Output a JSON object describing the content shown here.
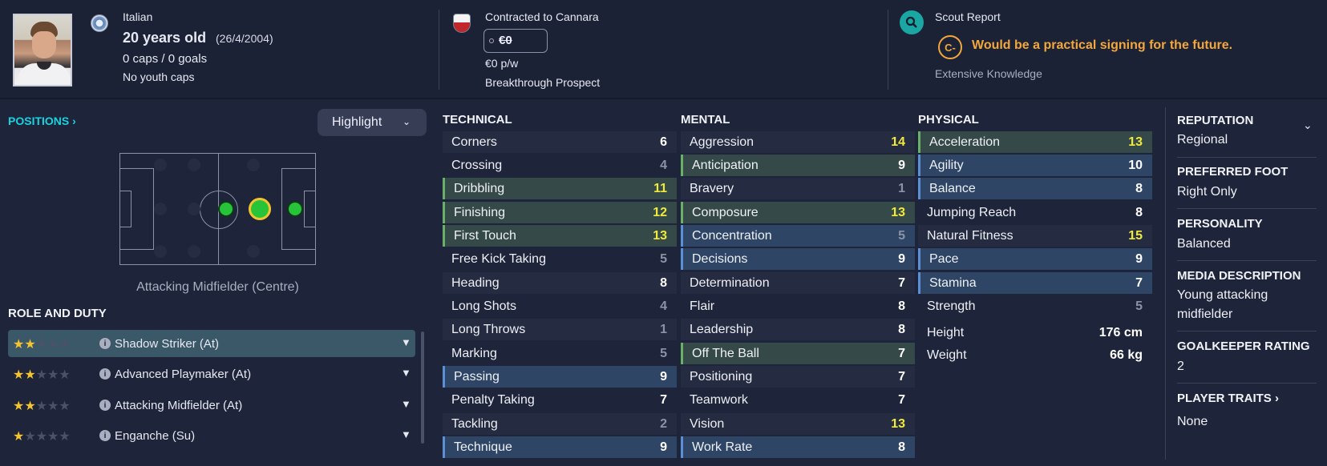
{
  "header": {
    "nationality": "Italian",
    "age_main": "20 years old",
    "dob": "(26/4/2004)",
    "caps": "0 caps / 0 goals",
    "youth_caps": "No youth caps",
    "contract": "Contracted to Cannara",
    "value": "€0",
    "wage": "€0 p/w",
    "status": "Breakthrough Prospect",
    "scout_title": "Scout Report",
    "scout_grade": "C-",
    "scout_text": "Would be a practical signing for the future.",
    "scout_knowledge": "Extensive Knowledge",
    "scout_color": "#f4a73a"
  },
  "positions": {
    "title": "POSITIONS",
    "highlight_label": "Highlight",
    "position_caption": "Attacking Midfielder (Centre)"
  },
  "role_duty": {
    "title": "ROLE AND DUTY",
    "roles": [
      {
        "label": "Shadow Striker (At)",
        "stars": 2
      },
      {
        "label": "Advanced Playmaker (At)",
        "stars": 2
      },
      {
        "label": "Attacking Midfielder (At)",
        "stars": 2
      },
      {
        "label": "Enganche (Su)",
        "stars": 1
      }
    ]
  },
  "technical": {
    "title": "TECHNICAL",
    "items": [
      {
        "name": "Corners",
        "value": "6"
      },
      {
        "name": "Crossing",
        "value": "4"
      },
      {
        "name": "Dribbling",
        "value": "11"
      },
      {
        "name": "Finishing",
        "value": "12"
      },
      {
        "name": "First Touch",
        "value": "13"
      },
      {
        "name": "Free Kick Taking",
        "value": "5"
      },
      {
        "name": "Heading",
        "value": "8"
      },
      {
        "name": "Long Shots",
        "value": "4"
      },
      {
        "name": "Long Throws",
        "value": "1"
      },
      {
        "name": "Marking",
        "value": "5"
      },
      {
        "name": "Passing",
        "value": "9"
      },
      {
        "name": "Penalty Taking",
        "value": "7"
      },
      {
        "name": "Tackling",
        "value": "2"
      },
      {
        "name": "Technique",
        "value": "9"
      }
    ]
  },
  "mental": {
    "title": "MENTAL",
    "items": [
      {
        "name": "Aggression",
        "value": "14"
      },
      {
        "name": "Anticipation",
        "value": "9"
      },
      {
        "name": "Bravery",
        "value": "1"
      },
      {
        "name": "Composure",
        "value": "13"
      },
      {
        "name": "Concentration",
        "value": "5"
      },
      {
        "name": "Decisions",
        "value": "9"
      },
      {
        "name": "Determination",
        "value": "7"
      },
      {
        "name": "Flair",
        "value": "8"
      },
      {
        "name": "Leadership",
        "value": "8"
      },
      {
        "name": "Off The Ball",
        "value": "7"
      },
      {
        "name": "Positioning",
        "value": "7"
      },
      {
        "name": "Teamwork",
        "value": "7"
      },
      {
        "name": "Vision",
        "value": "13"
      },
      {
        "name": "Work Rate",
        "value": "8"
      }
    ]
  },
  "physical": {
    "title": "PHYSICAL",
    "items": [
      {
        "name": "Acceleration",
        "value": "13"
      },
      {
        "name": "Agility",
        "value": "10"
      },
      {
        "name": "Balance",
        "value": "8"
      },
      {
        "name": "Jumping Reach",
        "value": "8"
      },
      {
        "name": "Natural Fitness",
        "value": "15"
      },
      {
        "name": "Pace",
        "value": "9"
      },
      {
        "name": "Stamina",
        "value": "7"
      },
      {
        "name": "Strength",
        "value": "5"
      }
    ],
    "height_label": "Height",
    "height_value": "176 cm",
    "weight_label": "Weight",
    "weight_value": "66 kg"
  },
  "side": {
    "reputation_label": "REPUTATION",
    "reputation_value": "Regional",
    "foot_label": "PREFERRED FOOT",
    "foot_value": "Right Only",
    "personality_label": "PERSONALITY",
    "personality_value": "Balanced",
    "media_label": "MEDIA DESCRIPTION",
    "media_value_1": "Young attacking",
    "media_value_2": "midfielder",
    "gk_label": "GOALKEEPER RATING",
    "gk_value": "2",
    "traits_label": "PLAYER TRAITS",
    "traits_value": "None"
  },
  "colors": {
    "background": "#1e2439",
    "accent_cyan": "#19d3e0",
    "green_highlight": "#354a48",
    "blue_highlight": "#2e4566",
    "yellow_value": "#f0ea3c"
  }
}
